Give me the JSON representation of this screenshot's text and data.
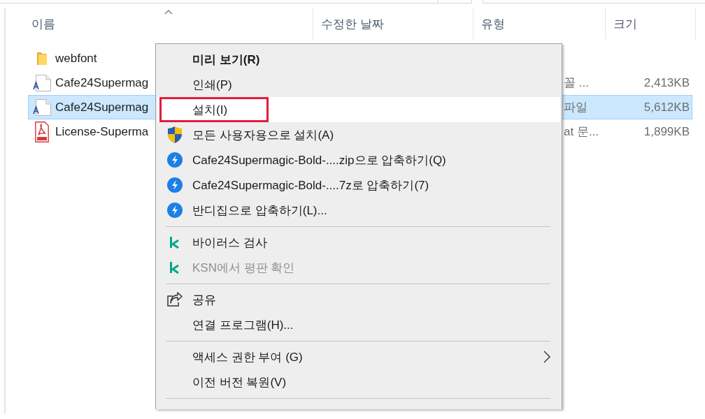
{
  "columns": [
    {
      "label": "이름",
      "sorted": true
    },
    {
      "label": "수정한 날짜",
      "sorted": false
    },
    {
      "label": "유형",
      "sorted": false
    },
    {
      "label": "크기",
      "sorted": false
    }
  ],
  "files": [
    {
      "kind": "folder",
      "name": "webfont",
      "selected": false
    },
    {
      "kind": "font",
      "name": "Cafe24Supermag",
      "type": "꼴 ...",
      "size": "2,413KB",
      "selected": false
    },
    {
      "kind": "font",
      "name": "Cafe24Supermag",
      "type": "파일",
      "size": "5,612KB",
      "selected": true
    },
    {
      "kind": "pdf",
      "name": "License-Superma",
      "type": "at 문...",
      "size": "1,899KB",
      "selected": false
    }
  ],
  "context_menu": {
    "items": [
      {
        "kind": "plain",
        "label": "미리 보기(R)",
        "default": true,
        "disabled": false,
        "selected": false,
        "marked": false,
        "submenu": false
      },
      {
        "kind": "plain",
        "label": "인쇄(P)",
        "default": false,
        "disabled": false,
        "selected": false,
        "marked": false,
        "submenu": false
      },
      {
        "kind": "plain",
        "label": "설치(I)",
        "default": false,
        "disabled": false,
        "selected": true,
        "marked": true,
        "submenu": false
      },
      {
        "kind": "shield",
        "label": "모든 사용자용으로 설치(A)",
        "default": false,
        "disabled": false,
        "selected": false,
        "marked": false,
        "submenu": false
      },
      {
        "kind": "archive",
        "label": "Cafe24Supermagic-Bold-....zip으로 압축하기(Q)",
        "default": false,
        "disabled": false,
        "selected": false,
        "marked": false,
        "submenu": false
      },
      {
        "kind": "archive",
        "label": "Cafe24Supermagic-Bold-....7z로 압축하기(7)",
        "default": false,
        "disabled": false,
        "selected": false,
        "marked": false,
        "submenu": false
      },
      {
        "kind": "archive",
        "label": "반디집으로 압축하기(L)...",
        "default": false,
        "disabled": false,
        "selected": false,
        "marked": false,
        "submenu": false
      },
      {
        "kind": "separator"
      },
      {
        "kind": "antivirus",
        "label": "바이러스 검사",
        "default": false,
        "disabled": false,
        "selected": false,
        "marked": false,
        "submenu": false
      },
      {
        "kind": "antivirus",
        "label": "KSN에서 평판 확인",
        "default": false,
        "disabled": true,
        "selected": false,
        "marked": false,
        "submenu": false
      },
      {
        "kind": "separator"
      },
      {
        "kind": "share",
        "label": "공유",
        "default": false,
        "disabled": false,
        "selected": false,
        "marked": false,
        "submenu": false
      },
      {
        "kind": "plain",
        "label": "연결 프로그램(H)...",
        "default": false,
        "disabled": false,
        "selected": false,
        "marked": false,
        "submenu": false
      },
      {
        "kind": "separator"
      },
      {
        "kind": "plain",
        "label": "액세스 권한 부여 (G)",
        "default": false,
        "disabled": false,
        "selected": false,
        "marked": false,
        "submenu": true
      },
      {
        "kind": "plain",
        "label": "이전 버전 복원(V)",
        "default": false,
        "disabled": false,
        "selected": false,
        "marked": false,
        "submenu": false
      },
      {
        "kind": "separator"
      }
    ]
  }
}
